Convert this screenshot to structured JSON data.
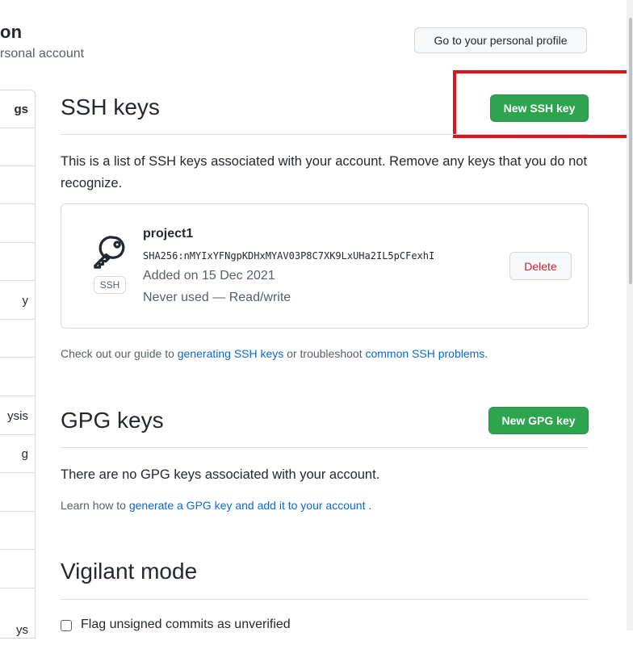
{
  "header": {
    "title": "on",
    "subtitle": "rsonal account",
    "profile_button": "Go to your personal profile"
  },
  "sidebar": {
    "items": [
      {
        "label": "gs",
        "selected": true
      },
      {
        "label": ""
      },
      {
        "label": ""
      },
      {
        "label": ""
      },
      {
        "label": ""
      },
      {
        "label": "y"
      },
      {
        "label": ""
      },
      {
        "label": ""
      },
      {
        "label": "ysis"
      },
      {
        "label": "g"
      },
      {
        "label": ""
      },
      {
        "label": ""
      },
      {
        "label": ""
      },
      {
        "label": "ys"
      }
    ]
  },
  "ssh": {
    "title": "SSH keys",
    "new_button": "New SSH key",
    "description": "This is a list of SSH keys associated with your account. Remove any keys that you do not recognize.",
    "keys": [
      {
        "name": "project1",
        "fingerprint": "SHA256:nMYIxYFNgpKDHxMYAV03P8C7XK9LxUHa2IL5pCFexhI",
        "added": "Added on 15 Dec 2021",
        "usage": "Never used — Read/write",
        "badge": "SSH",
        "icon": "key-icon",
        "delete_label": "Delete"
      }
    ],
    "guide": {
      "prefix": "Check out our guide to ",
      "link1": "generating SSH keys",
      "middle": " or troubleshoot ",
      "link2": "common SSH problems",
      "suffix": "."
    }
  },
  "gpg": {
    "title": "GPG keys",
    "new_button": "New GPG key",
    "empty_text": "There are no GPG keys associated with your account.",
    "learn": {
      "prefix": "Learn how to ",
      "link": "generate a GPG key and add it to your account",
      "suffix": " ."
    }
  },
  "vigilant": {
    "title": "Vigilant mode",
    "checkbox_label": "Flag unsigned commits as unverified",
    "checked": false
  },
  "colors": {
    "accent_green": "#2da44e",
    "link_blue": "#0969da",
    "danger_red": "#cf222e",
    "highlight_red": "#e3111b"
  }
}
